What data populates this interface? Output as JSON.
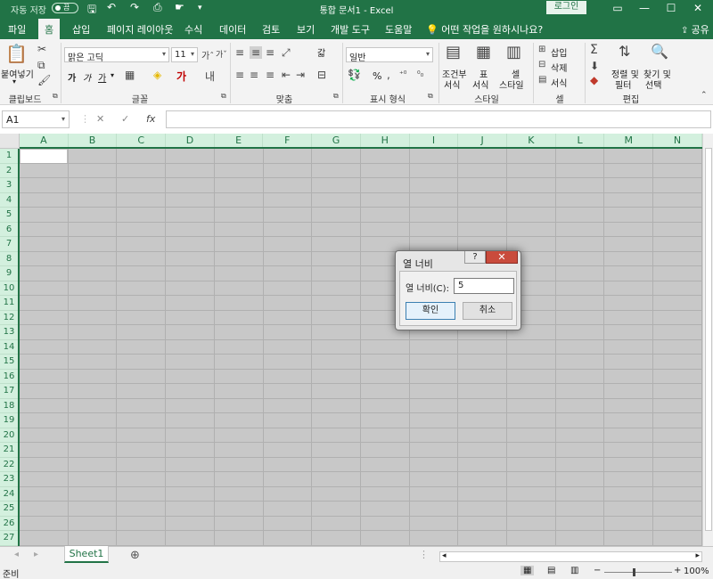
{
  "titlebar": {
    "autosave_label": "자동 저장",
    "autosave_state": "끔",
    "doc_title": "통합 문서1 - Excel",
    "login": "로그인"
  },
  "tabs": [
    "파일",
    "홈",
    "삽입",
    "페이지 레이아웃",
    "수식",
    "데이터",
    "검토",
    "보기",
    "개발 도구",
    "도움말"
  ],
  "tellme": "어떤 작업을 원하시나요?",
  "share": "공유",
  "ribbon": {
    "clipboard": {
      "paste": "붙여넣기",
      "label": "클립보드"
    },
    "font": {
      "name": "맑은 고딕",
      "size": "11",
      "label": "글꼴",
      "bold": "가",
      "italic": "가",
      "underline": "가"
    },
    "align": {
      "label": "맞춤",
      "wrap": "갋"
    },
    "number": {
      "format": "일반",
      "label": "표시 형식",
      "percent": "%"
    },
    "styles": {
      "conditional": "조건부",
      "conditional2": "서식",
      "table": "표",
      "table2": "서식",
      "cell": "셀",
      "cell2": "스타일",
      "label": "스타일"
    },
    "cells": {
      "insert": "삽입",
      "delete": "삭제",
      "format": "서식",
      "label": "셀"
    },
    "editing": {
      "sort": "정렬 및",
      "sort2": "필터",
      "find": "찾기 및",
      "find2": "선택",
      "label": "편집"
    }
  },
  "formula_bar": {
    "namebox": "A1",
    "cancel": "✕",
    "enter": "✓",
    "fx": "fx"
  },
  "columns": [
    "A",
    "B",
    "C",
    "D",
    "E",
    "F",
    "G",
    "H",
    "I",
    "J",
    "K",
    "L",
    "M",
    "N"
  ],
  "rows": [
    "1",
    "2",
    "3",
    "4",
    "5",
    "6",
    "7",
    "8",
    "9",
    "10",
    "11",
    "12",
    "13",
    "14",
    "15",
    "16",
    "17",
    "18",
    "19",
    "20",
    "21",
    "22",
    "23",
    "24",
    "25",
    "26",
    "27"
  ],
  "sheet_tab": "Sheet1",
  "status": {
    "ready": "준비",
    "zoom": "100%"
  },
  "dialog": {
    "title": "열 너비",
    "help": "?",
    "close": "✕",
    "label": "열 너비(C):",
    "value": "5",
    "ok": "확인",
    "cancel": "취소"
  }
}
